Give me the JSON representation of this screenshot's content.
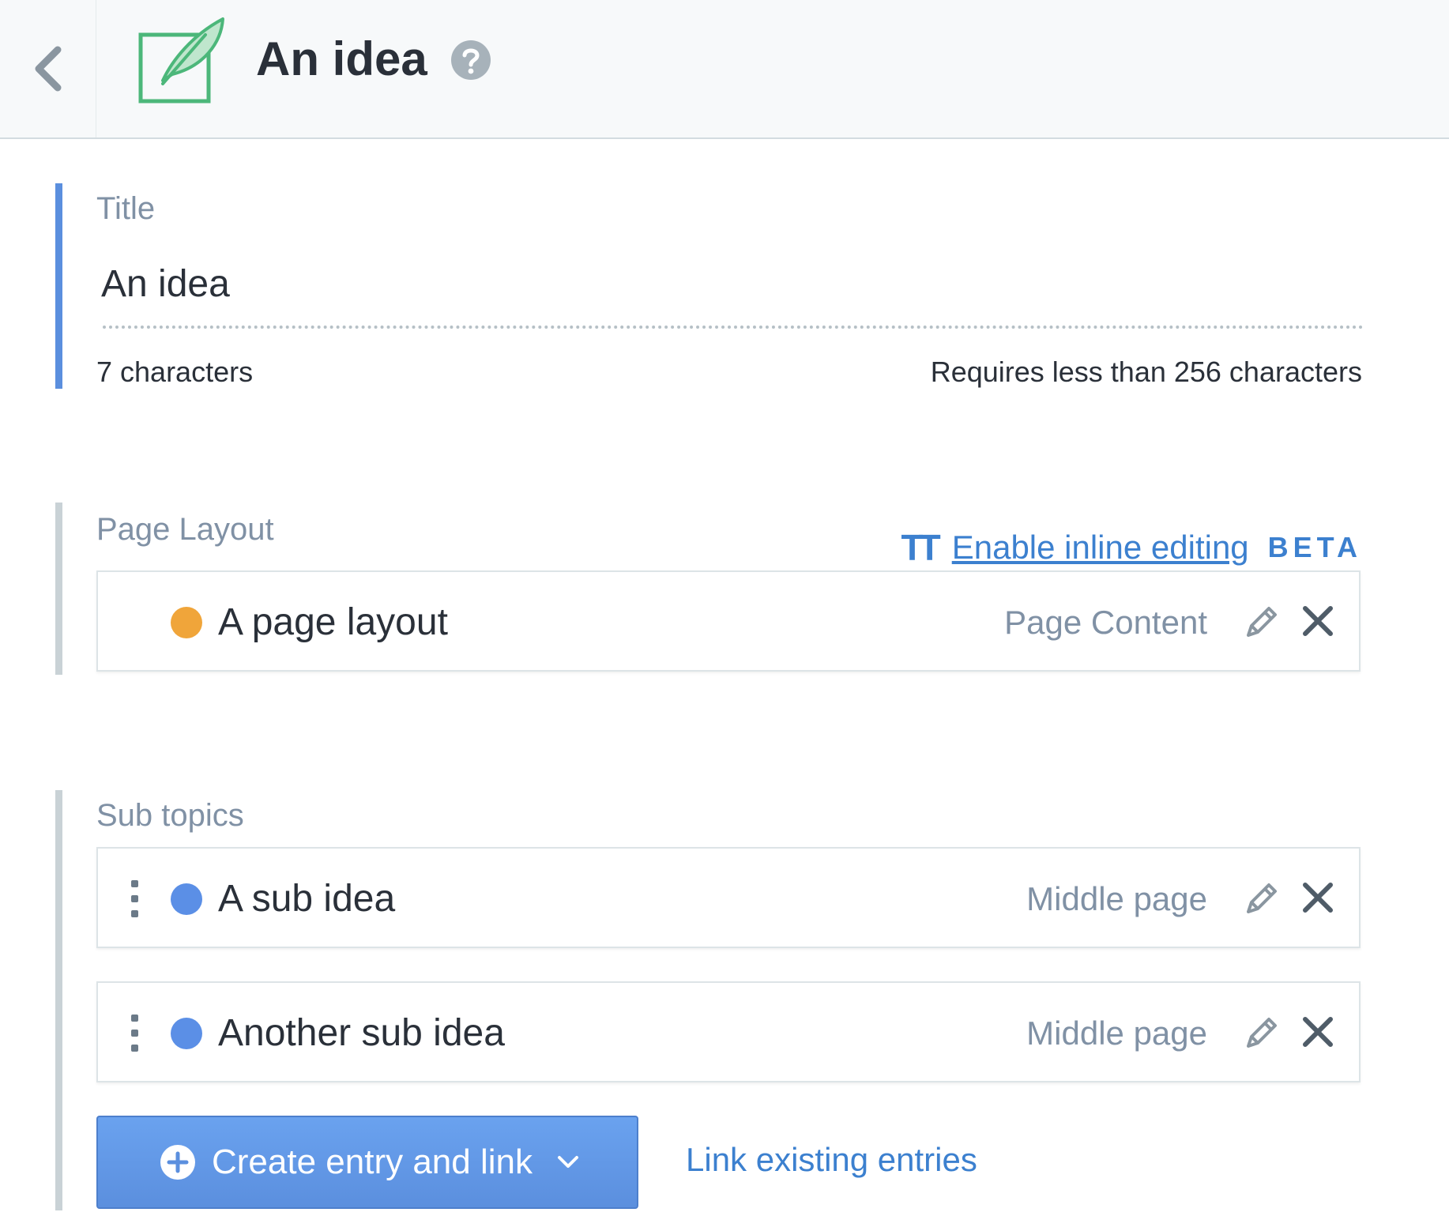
{
  "header": {
    "title": "An idea",
    "back_icon": "chevron-left-icon",
    "entry_icon": "feather-edit-icon",
    "help_icon": "help-circle-icon"
  },
  "title_field": {
    "label": "Title",
    "value": "An idea",
    "char_count": "7 characters",
    "requirement": "Requires less than 256 characters"
  },
  "page_layout_field": {
    "label": "Page Layout",
    "inline_editing": {
      "icon": "text-size-icon",
      "icon_text": "TT",
      "link_label": "Enable inline editing",
      "badge": "BETA"
    },
    "entries": [
      {
        "title": "A page layout",
        "content_type": "Page Content",
        "status_color": "#f0a53a"
      }
    ]
  },
  "sub_topics_field": {
    "label": "Sub topics",
    "entries": [
      {
        "title": "A sub idea",
        "content_type": "Middle page",
        "status_color": "#5b8fe6"
      },
      {
        "title": "Another sub idea",
        "content_type": "Middle page",
        "status_color": "#5b8fe6"
      }
    ],
    "create_button_label": "Create entry and link",
    "link_existing_label": "Link existing entries"
  },
  "colors": {
    "accent": "#5b8fde",
    "link": "#3c80cf",
    "entry_icon_green": "#4cb77a"
  }
}
